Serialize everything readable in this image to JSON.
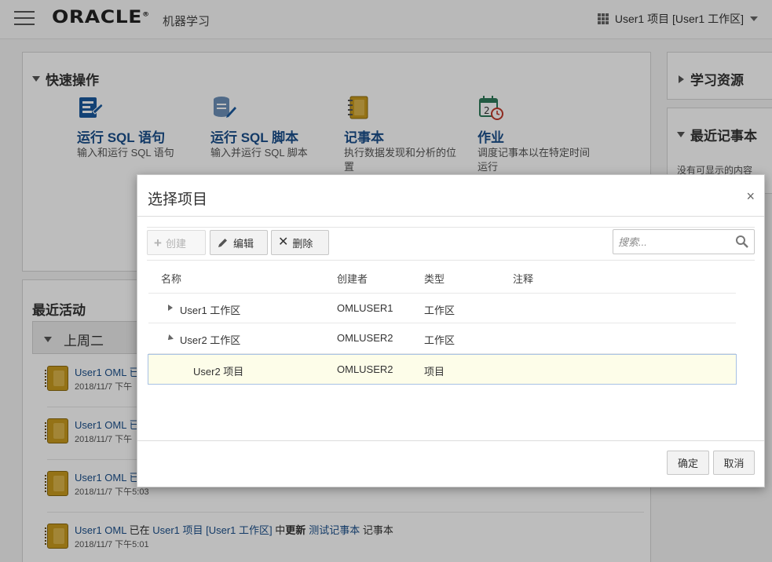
{
  "header": {
    "logo_text": "ORACLE",
    "logo_mark": "®",
    "product_name": "机器学习",
    "project_switcher": "User1 项目 [User1 工作区]",
    "menu_icon": "hamburger-menu-icon",
    "grid_icon": "grid-icon"
  },
  "quick_actions": {
    "title": "快速操作",
    "items": [
      {
        "title": "运行 SQL 语句",
        "desc": "输入和运行 SQL 语句",
        "icon": "sql-query-icon"
      },
      {
        "title": "运行 SQL 脚本",
        "desc": "输入并运行 SQL 脚本",
        "icon": "sql-script-icon"
      },
      {
        "title": "记事本",
        "desc": "执行数据发现和分析的位置",
        "icon": "notebook-icon"
      },
      {
        "title": "作业",
        "desc": "调度记事本以在特定时间运行",
        "icon": "calendar-clock-icon"
      }
    ]
  },
  "learning": {
    "title": "学习资源"
  },
  "recent_notebooks": {
    "title": "最近记事本",
    "empty_text": "没有可显示的内容"
  },
  "recent_activity": {
    "title": "最近活动",
    "week_label": "上周二",
    "items": [
      {
        "text": "User1 OML 已",
        "time": "2018/11/7 下午"
      },
      {
        "text": "User1 OML 已",
        "time": "2018/11/7 下午"
      },
      {
        "text": "User1 OML 已",
        "time": "2018/11/7 下午5:03"
      },
      {
        "user": "User1 OML",
        "t1": " 已在 ",
        "project": "User1 项目 [User1 工作区]",
        "t2": " 中",
        "action": "更新",
        "notebook": "测试记事本",
        "t3": " 记事本",
        "time": "2018/11/7 下午5:01"
      }
    ]
  },
  "dialog": {
    "title": "选择项目",
    "close": "×",
    "toolbar": {
      "create": "创建",
      "edit": "编辑",
      "delete": "删除",
      "search_placeholder": "搜索..."
    },
    "columns": [
      "名称",
      "创建者",
      "类型",
      "注释"
    ],
    "rows": [
      {
        "name": "User1 工作区",
        "creator": "OMLUSER1",
        "type": "工作区",
        "comment": "",
        "expanded": false,
        "indent": 0
      },
      {
        "name": "User2 工作区",
        "creator": "OMLUSER2",
        "type": "工作区",
        "comment": "",
        "expanded": true,
        "indent": 0
      },
      {
        "name": "User2 项目",
        "creator": "OMLUSER2",
        "type": "项目",
        "comment": "",
        "selected": true,
        "indent": 1
      }
    ],
    "ok": "确定",
    "cancel": "取消"
  },
  "colors": {
    "link": "#1a4f8b",
    "notebook": "#c89a1e",
    "selected_row": "#fdfde9",
    "selected_border": "#a7c1e4"
  }
}
